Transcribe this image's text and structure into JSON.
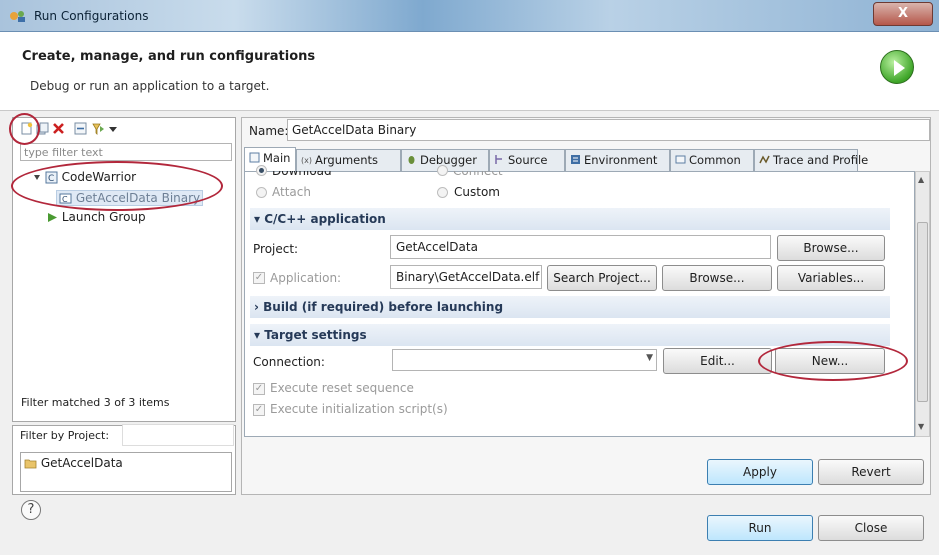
{
  "window": {
    "title": "Run Configurations",
    "close_label": "X"
  },
  "header": {
    "title": "Create, manage, and run configurations",
    "subtitle": "Debug or run an application to a target."
  },
  "left": {
    "filter_placeholder": "type filter text",
    "tree": [
      {
        "label": "CodeWarrior",
        "expanded": true
      },
      {
        "label": "GetAccelData Binary",
        "selected": true
      },
      {
        "label": "Launch Group"
      }
    ],
    "status": "Filter matched 3 of 3 items",
    "filter_by_project_label": "Filter by Project:",
    "projects": [
      "GetAccelData"
    ]
  },
  "config": {
    "name_label": "Name:",
    "name_value": "GetAccelData Binary",
    "tabs": [
      "Main",
      "Arguments",
      "Debugger",
      "Source",
      "Environment",
      "Common",
      "Trace and Profile"
    ],
    "active_tab": "Main",
    "launch_modes": {
      "download": "Download",
      "connect": "Connect",
      "attach": "Attach",
      "custom": "Custom"
    },
    "sections": {
      "c_app": "C/C++ application",
      "build": "Build (if required) before launching",
      "target": "Target settings"
    },
    "project_label": "Project:",
    "project_value": "GetAccelData",
    "application_label": "Application:",
    "application_value": "Binary\\GetAccelData.elf",
    "buttons": {
      "browse_project": "Browse...",
      "search_project": "Search Project...",
      "browse_app": "Browse...",
      "variables": "Variables...",
      "edit": "Edit...",
      "new": "New...",
      "apply": "Apply",
      "revert": "Revert",
      "run": "Run",
      "close": "Close"
    },
    "connection_label": "Connection:",
    "connection_value": "",
    "checks": {
      "reset": "Execute reset sequence",
      "init": "Execute initialization script(s)"
    }
  },
  "help_symbol": "?"
}
